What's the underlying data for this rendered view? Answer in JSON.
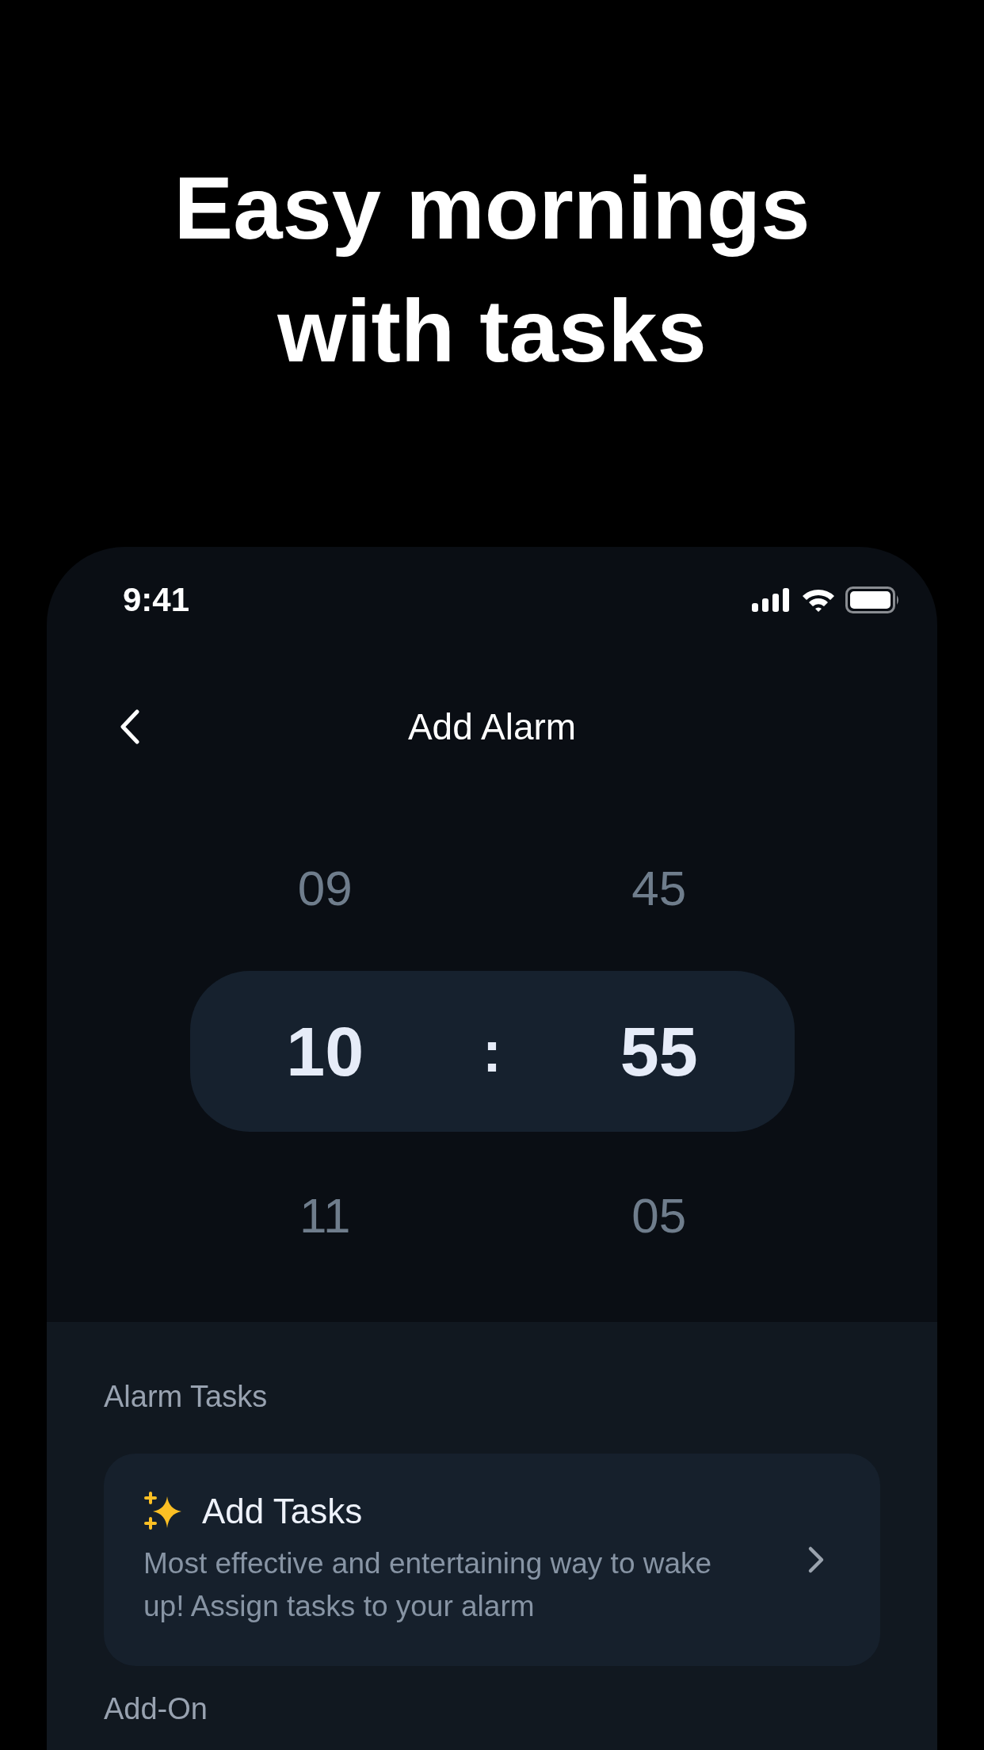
{
  "headline": "Easy mornings with tasks",
  "status_bar": {
    "time": "9:41"
  },
  "nav": {
    "title": "Add Alarm"
  },
  "picker": {
    "hours": [
      {
        "value": "09",
        "selected": false
      },
      {
        "value": "10",
        "selected": true
      },
      {
        "value": "11",
        "selected": false
      }
    ],
    "separator": ":",
    "minutes": [
      {
        "value": "45",
        "selected": false
      },
      {
        "value": "55",
        "selected": true
      },
      {
        "value": "05",
        "selected": false
      }
    ]
  },
  "alarm_tasks": {
    "heading": "Alarm Tasks",
    "card": {
      "title": "Add Tasks",
      "description": "Most effective and entertaining way to wake up! Assign tasks to your alarm"
    }
  },
  "add_on": {
    "heading": "Add-On"
  }
}
